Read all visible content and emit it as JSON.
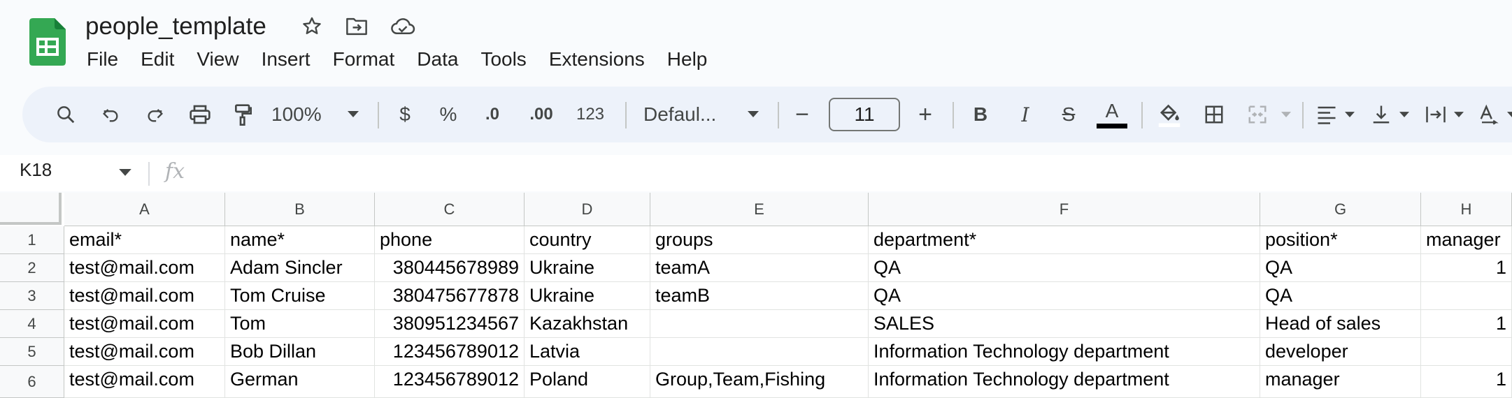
{
  "doc": {
    "title": "people_template"
  },
  "menu": [
    "File",
    "Edit",
    "View",
    "Insert",
    "Format",
    "Data",
    "Tools",
    "Extensions",
    "Help"
  ],
  "toolbar": {
    "zoom": "100%",
    "currency": "$",
    "percent": "%",
    "decrease_decimal": ".0",
    "increase_decimal": ".00",
    "more_formats": "123",
    "font": "Defaul...",
    "font_size": "11",
    "minus": "−",
    "plus": "+",
    "bold": "B",
    "italic": "I",
    "strike": "S",
    "text_color_letter": "A",
    "text_color": "#000000"
  },
  "formula_bar": {
    "name_box": "K18",
    "fx": "fx"
  },
  "columns": [
    "A",
    "B",
    "C",
    "D",
    "E",
    "F",
    "G",
    "H"
  ],
  "rows": [
    {
      "num": "1",
      "cells": [
        "email*",
        "name*",
        "phone",
        "country",
        "groups",
        "department*",
        "position*",
        "manager"
      ]
    },
    {
      "num": "2",
      "cells": [
        "test@mail.com",
        "Adam Sincler",
        "380445678989",
        "Ukraine",
        "teamA",
        "QA",
        "QA",
        "1"
      ]
    },
    {
      "num": "3",
      "cells": [
        "test@mail.com",
        "Tom Cruise",
        "380475677878",
        "Ukraine",
        "teamB",
        "QA",
        "QA",
        ""
      ]
    },
    {
      "num": "4",
      "cells": [
        "test@mail.com",
        "Tom",
        "380951234567",
        "Kazakhstan",
        "",
        "SALES",
        "Head of sales",
        "1"
      ]
    },
    {
      "num": "5",
      "cells": [
        "test@mail.com",
        "Bob Dillan",
        "123456789012",
        "Latvia",
        "",
        "Information Technology department",
        "developer",
        ""
      ]
    },
    {
      "num": "6",
      "cells": [
        "test@mail.com",
        "German",
        "123456789012",
        "Poland",
        "Group,Team,Fishing",
        "Information Technology department",
        "manager",
        "1"
      ]
    }
  ],
  "colors": {
    "brand_green": "#0f9d58",
    "toolbar_bg": "#edf2fa",
    "page_bg": "#f9fbfd"
  }
}
